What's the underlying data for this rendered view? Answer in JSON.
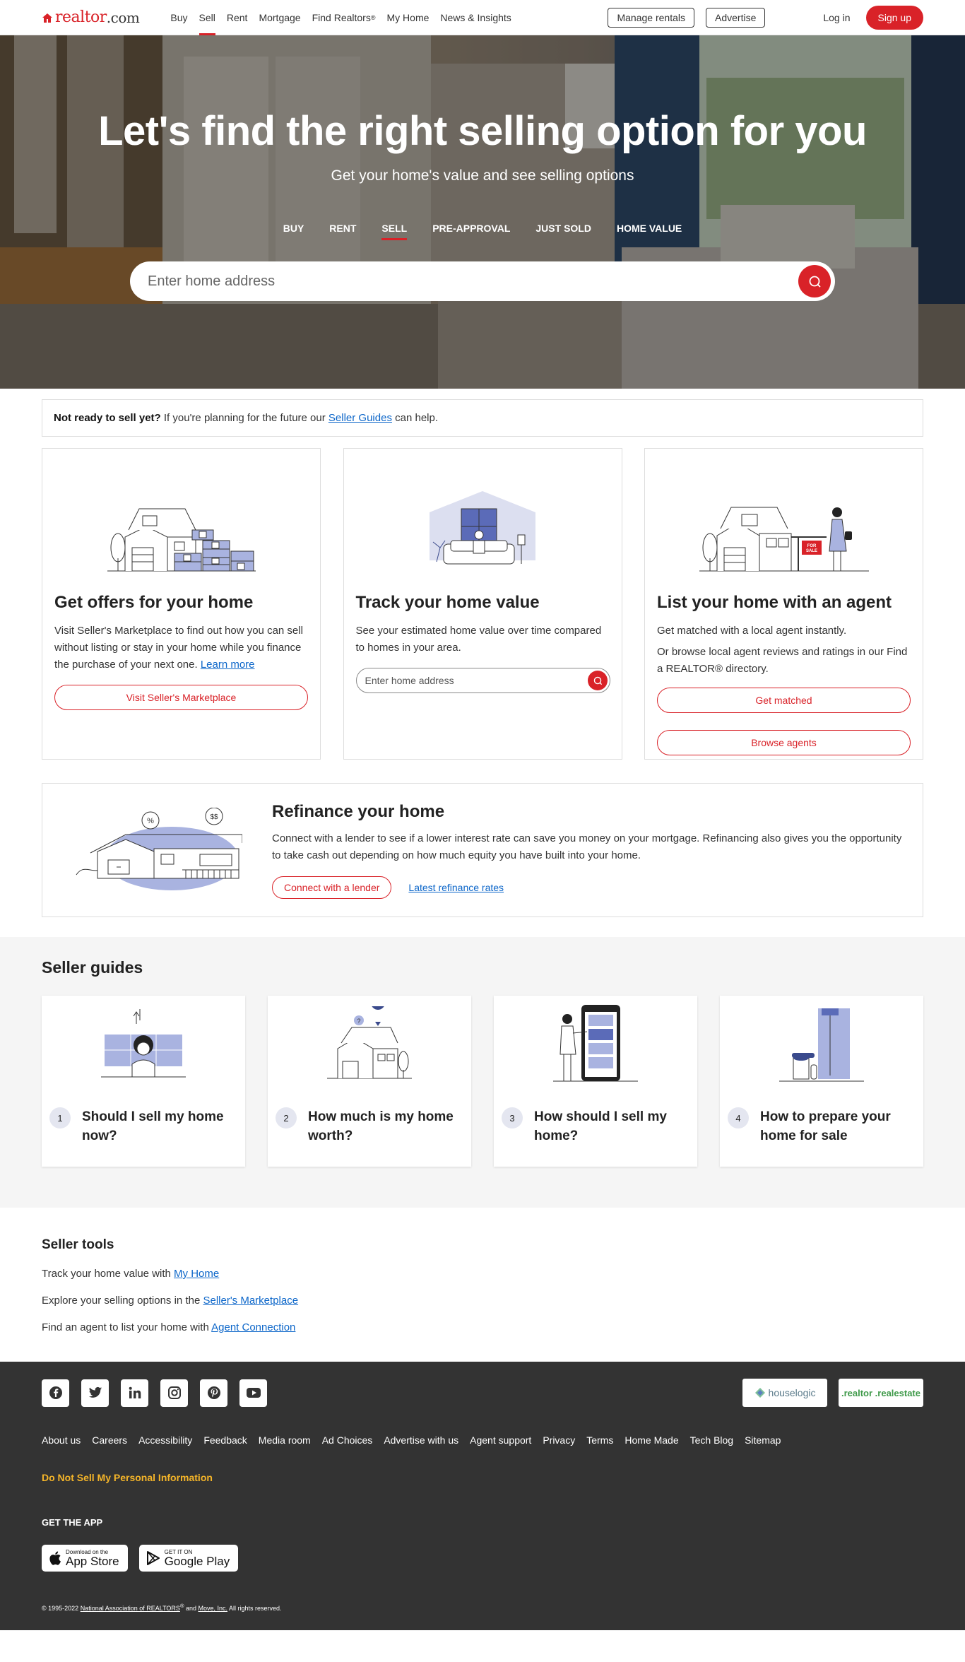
{
  "header": {
    "logo_main": "realtor",
    "logo_suffix": ".com",
    "nav": [
      {
        "label": "Buy"
      },
      {
        "label": "Sell",
        "active": true
      },
      {
        "label": "Rent"
      },
      {
        "label": "Mortgage"
      },
      {
        "label": "Find Realtors"
      },
      {
        "label": "My Home"
      },
      {
        "label": "News & Insights"
      }
    ],
    "nav_sup": "®",
    "manage_rentals": "Manage rentals",
    "advertise": "Advertise",
    "login": "Log in",
    "signup": "Sign up"
  },
  "hero": {
    "title": "Let's find the right selling option for you",
    "subtitle": "Get your home's value and see selling options",
    "tabs": [
      "BUY",
      "RENT",
      "SELL",
      "PRE-APPROVAL",
      "JUST SOLD",
      "HOME VALUE"
    ],
    "active_tab": "SELL",
    "search_placeholder": "Enter home address"
  },
  "notice": {
    "bold": "Not ready to sell yet?",
    "text": " If you're planning for the future our ",
    "link": "Seller Guides",
    "tail": " can help."
  },
  "cards": {
    "offers": {
      "title": "Get offers for your home",
      "text": "Visit Seller's Marketplace to find out how you can sell without listing or stay in your home while you finance the purchase of your next one. ",
      "link": "Learn more",
      "button": "Visit Seller's Marketplace"
    },
    "track": {
      "title": "Track your home value",
      "text": "See your estimated home value over time compared to homes in your area.",
      "search_placeholder": "Enter home address"
    },
    "agent": {
      "title": "List your home with an agent",
      "text1": "Get matched with a local agent instantly.",
      "text2": "Or browse local agent reviews and ratings in our Find a REALTOR® directory.",
      "button1": "Get matched",
      "button2": "Browse agents"
    }
  },
  "refinance": {
    "title": "Refinance your home",
    "text": "Connect with a lender to see if a lower interest rate can save you money on your mortgage. Refinancing also gives you the opportunity to take cash out depending on how much equity you have built into your home.",
    "button": "Connect with a lender",
    "link": "Latest refinance rates",
    "bubble1": "%",
    "bubble2": "$$"
  },
  "guides": {
    "title": "Seller guides",
    "items": [
      {
        "num": "1",
        "title": "Should I sell my home now?"
      },
      {
        "num": "2",
        "title": "How much is my home worth?"
      },
      {
        "num": "3",
        "title": "How should I sell my home?"
      },
      {
        "num": "4",
        "title": "How to prepare your home for sale"
      }
    ]
  },
  "tools": {
    "title": "Seller tools",
    "items": [
      {
        "text": "Track your home value with ",
        "link": "My Home"
      },
      {
        "text": "Explore your selling options in the ",
        "link": "Seller's Marketplace"
      },
      {
        "text": "Find an agent to list your home with ",
        "link": "Agent Connection"
      }
    ]
  },
  "footer": {
    "social": [
      "facebook-icon",
      "twitter-icon",
      "linkedin-icon",
      "instagram-icon",
      "pinterest-icon",
      "youtube-icon"
    ],
    "partners": [
      "houselogic",
      ".realtor .realestate"
    ],
    "links": [
      "About us",
      "Careers",
      "Accessibility",
      "Feedback",
      "Media room",
      "Ad Choices",
      "Advertise with us",
      "Agent support",
      "Privacy",
      "Terms",
      "Home Made",
      "Tech Blog",
      "Sitemap"
    ],
    "do_not_sell": "Do Not Sell My Personal Information",
    "get_app": "GET THE APP",
    "app_store_small": "Download on the",
    "app_store_big": "App Store",
    "google_small": "GET IT ON",
    "google_big": "Google Play",
    "copyright_prefix": "© 1995-2022 ",
    "copyright_nar": "National Association of REALTORS",
    "copyright_reg": "®",
    "copyright_and": " and ",
    "copyright_move": "Move, Inc.",
    "copyright_tail": " All rights reserved."
  },
  "colors": {
    "brand_red": "#d92228",
    "link_blue": "#0c66c9",
    "footer_bg": "#333333",
    "dns_yellow": "#f5b529",
    "illus_lavender": "#a9b3e0",
    "illus_navy": "#3a4a8c"
  }
}
